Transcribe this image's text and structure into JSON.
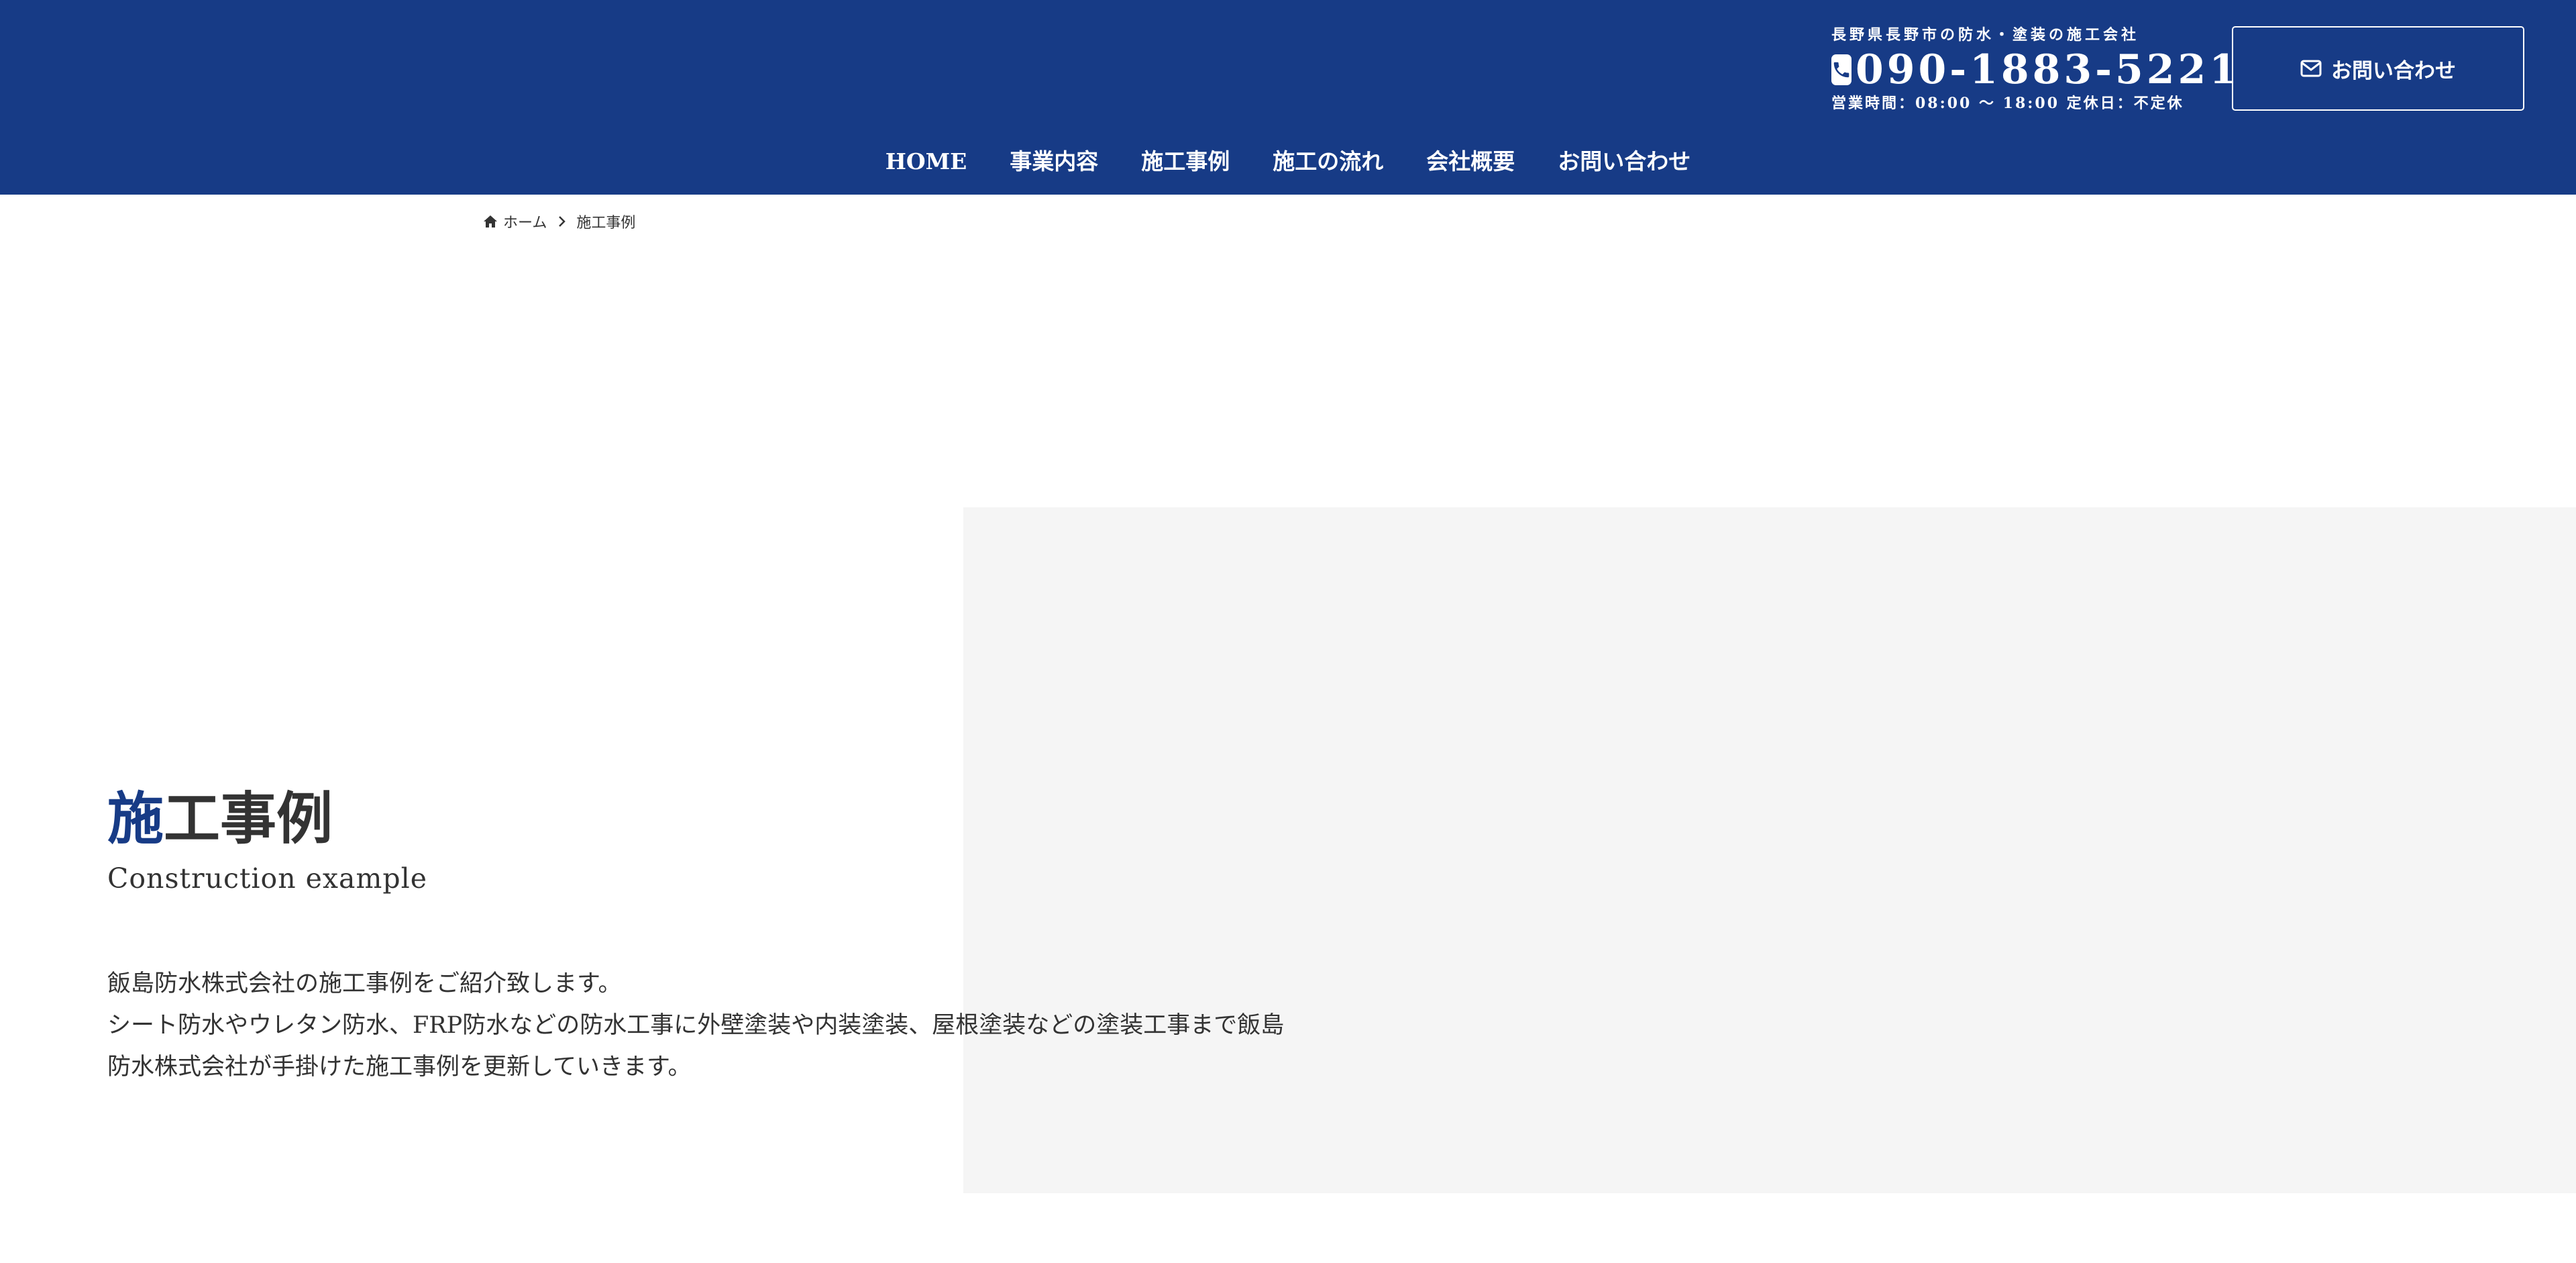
{
  "colors": {
    "brand": "#173b86",
    "text": "#333333",
    "hero_placeholder": "#f5f5f5",
    "background": "#ffffff"
  },
  "header": {
    "tagline": "長野県長野市の防水・塗装の施工会社",
    "phone_icon": "phone-square-icon",
    "phone": "090-1883-5221",
    "hours": "営業時間：08:00 〜 18:00  定休日：不定休",
    "contact_button": {
      "icon": "envelope-icon",
      "label": "お問い合わせ"
    },
    "nav": [
      "HOME",
      "事業内容",
      "施工事例",
      "施工の流れ",
      "会社概要",
      "お問い合わせ"
    ]
  },
  "breadcrumb": {
    "home_icon": "home-icon",
    "home": "ホーム",
    "separator_icon": "chevron-right-icon",
    "current": "施工事例"
  },
  "hero": {
    "title_accent": "施",
    "title_rest": "工事例",
    "subtitle": "Construction example",
    "intro_lines": [
      "飯島防水株式会社の施工事例をご紹介致します。",
      "シート防水やウレタン防水、FRP防水などの防水工事に外壁塗装や内装塗装、屋根塗装などの塗装工事まで飯島",
      "防水株式会社が手掛けた施工事例を更新していきます。"
    ]
  }
}
